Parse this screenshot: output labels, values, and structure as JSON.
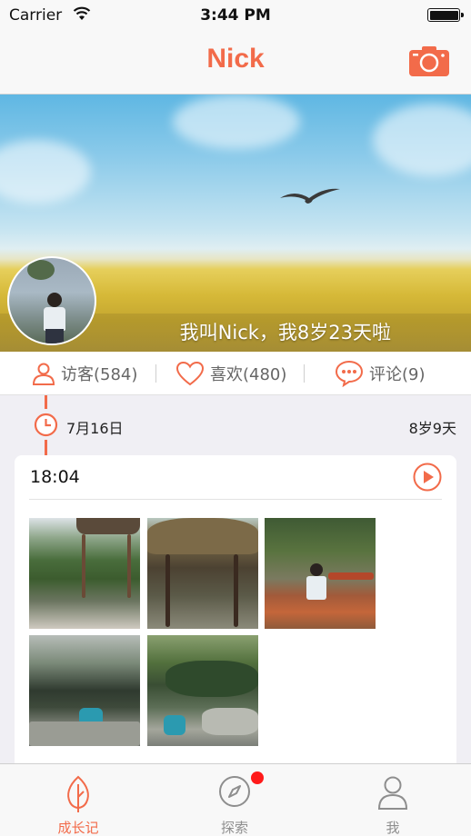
{
  "status_bar": {
    "carrier": "Carrier",
    "time": "3:44 PM"
  },
  "nav": {
    "title": "Nick",
    "camera_icon": "camera-icon"
  },
  "banner": {
    "caption": "我叫Nick，我8岁23天啦"
  },
  "stats": {
    "visitors": "访客(584)",
    "likes": "喜欢(480)",
    "comments": "评论(9)"
  },
  "timeline": {
    "date": "7月16日",
    "age": "8岁9天"
  },
  "card": {
    "time": "18:04",
    "photo_count": 5
  },
  "tabs": [
    {
      "label": "成长记",
      "icon": "leaf-icon",
      "active": true
    },
    {
      "label": "探索",
      "icon": "compass-icon",
      "active": false,
      "badge": true
    },
    {
      "label": "我",
      "icon": "person-icon",
      "active": false
    }
  ],
  "colors": {
    "accent": "#f26b4a",
    "badge": "#ff1a1a",
    "inactive": "#8e8e8e"
  }
}
